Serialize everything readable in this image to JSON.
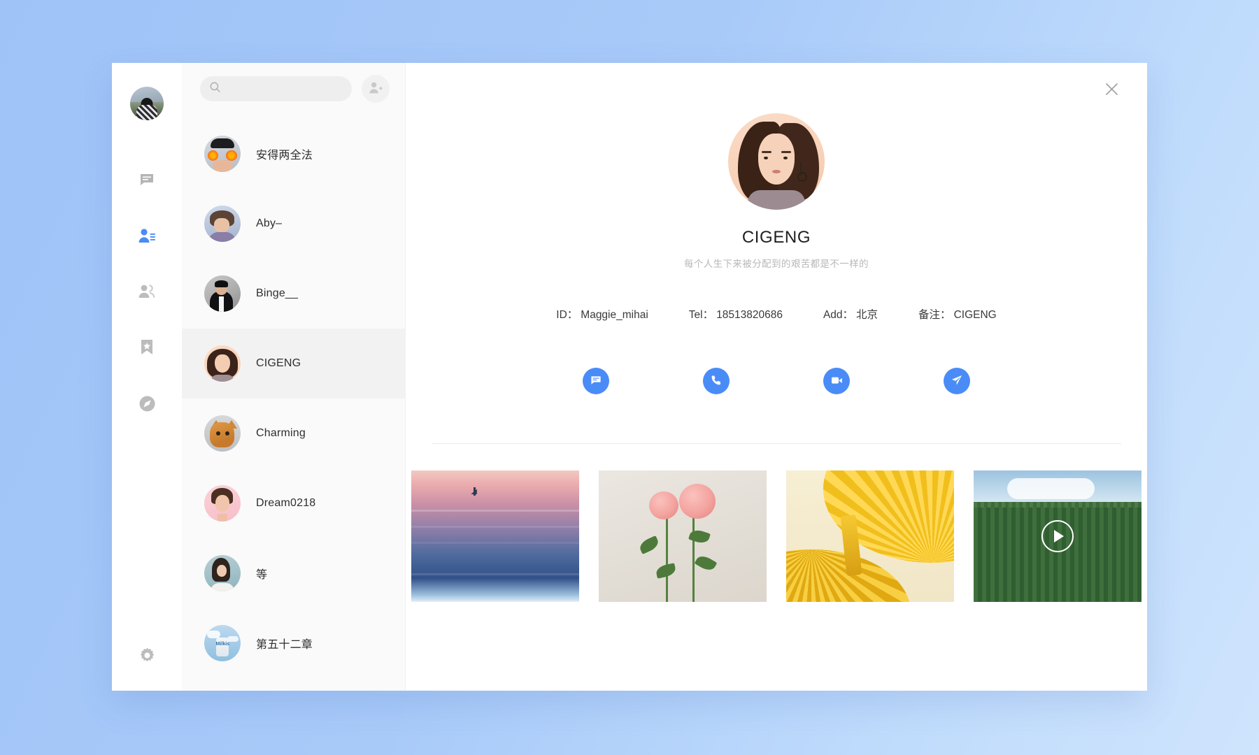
{
  "theme": {
    "accent": "#4a8cf7",
    "background_gradient_from": "#9fc3f7",
    "background_gradient_to": "#cfe4fd",
    "panel_bg": "#ffffff",
    "list_bg": "#fafafa",
    "active_row_bg": "#f2f2f2"
  },
  "rail": {
    "user_avatar_name": "user-avatar",
    "items": [
      {
        "name": "chat-icon",
        "label": "Chats",
        "active": false
      },
      {
        "name": "contacts-icon",
        "label": "Contacts",
        "active": true
      },
      {
        "name": "group-icon",
        "label": "Groups",
        "active": false
      },
      {
        "name": "favorites-icon",
        "label": "Favorites",
        "active": false
      },
      {
        "name": "discover-icon",
        "label": "Discover",
        "active": false
      }
    ],
    "settings": {
      "name": "settings-gear-icon",
      "label": "Settings"
    }
  },
  "search": {
    "value": "",
    "placeholder": "",
    "icon": "search-icon"
  },
  "add_contact": {
    "icon": "add-user-icon",
    "label": ""
  },
  "contacts": [
    {
      "name": "安得两全法",
      "avatar": "av-andeliang",
      "active": false
    },
    {
      "name": "Aby–",
      "avatar": "av-aby",
      "active": false
    },
    {
      "name": "Binge__",
      "avatar": "av-binge",
      "active": false
    },
    {
      "name": "CIGENG",
      "avatar": "av-cigeng",
      "active": true
    },
    {
      "name": "Charming",
      "avatar": "av-charming",
      "active": false
    },
    {
      "name": "Dream0218",
      "avatar": "av-dream",
      "active": false
    },
    {
      "name": "等",
      "avatar": "av-deng",
      "active": false
    },
    {
      "name": "第五十二章",
      "avatar": "av-chapter",
      "active": false
    }
  ],
  "detail": {
    "close_icon": "close-icon",
    "avatar_name": "profile-avatar",
    "name": "CIGENG",
    "signature": "每个人生下来被分配到的艰苦都是不一样的",
    "info": [
      {
        "key": "ID：",
        "value": "Maggie_mihai"
      },
      {
        "key": "Tel：",
        "value": "18513820686"
      },
      {
        "key": "Add：",
        "value": "北京"
      },
      {
        "key": "备注：",
        "value": "CIGENG"
      }
    ],
    "actions": [
      {
        "name": "send-message-button",
        "icon": "message-icon",
        "label": "Message"
      },
      {
        "name": "voice-call-button",
        "icon": "phone-icon",
        "label": "Voice Call"
      },
      {
        "name": "video-call-button",
        "icon": "video-icon",
        "label": "Video Call"
      },
      {
        "name": "send-file-button",
        "icon": "send-icon",
        "label": "Send"
      }
    ],
    "gallery": [
      {
        "name": "ocean-sunset-photo",
        "kind": "image",
        "alt": "Sunset ocean with sailboat"
      },
      {
        "name": "pink-roses-photo",
        "kind": "image",
        "alt": "Pink roses on wall"
      },
      {
        "name": "yellow-umbrella-photo",
        "kind": "image",
        "alt": "Yellow paper umbrellas"
      },
      {
        "name": "forest-video",
        "kind": "video",
        "alt": "Green forest hillside",
        "play_icon": "play-icon"
      }
    ]
  }
}
